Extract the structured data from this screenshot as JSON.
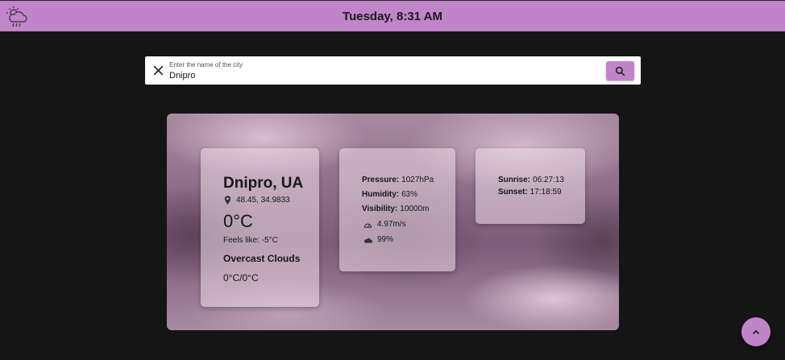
{
  "header": {
    "datetime": "Tuesday, 8:31 AM",
    "logo_icon": "cloud-sun-rain-icon"
  },
  "search": {
    "label": "Enter the name of the city",
    "value": "Dnipro",
    "clear_icon": "close-icon",
    "button_icon": "search-icon"
  },
  "weather": {
    "city": "Dnipro, UA",
    "coords": "48.45, 34.9833",
    "temp": "0°C",
    "feels_like": "Feels like: -5°C",
    "description": "Overcast Clouds",
    "min_max": "0°C/0°C",
    "pressure_label": "Pressure:",
    "pressure": "1027hPa",
    "humidity_label": "Humidity:",
    "humidity": "63%",
    "visibility_label": "Visibility:",
    "visibility": "10000m",
    "wind": "4.97m/s",
    "clouds": "99%",
    "sunrise_label": "Sunrise:",
    "sunrise": "06:27:13",
    "sunset_label": "Sunset:",
    "sunset": "17:18:59"
  },
  "colors": {
    "accent": "#c084c8",
    "background": "#151515"
  }
}
